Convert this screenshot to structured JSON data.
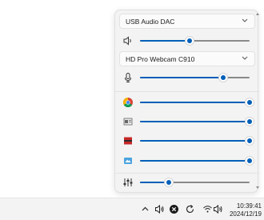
{
  "flyout": {
    "output_device": "USB Audio DAC",
    "output_volume_percent": 45,
    "input_device": "HD Pro Webcam C910",
    "input_volume_percent": 76,
    "apps": [
      {
        "icon": "chrome-icon",
        "volume_percent": 100
      },
      {
        "icon": "media-player-icon",
        "volume_percent": 100
      },
      {
        "icon": "red-app-icon",
        "volume_percent": 100
      },
      {
        "icon": "blue-app-icon",
        "volume_percent": 100
      }
    ],
    "system_sounds_volume_percent": 26
  },
  "colors": {
    "accent": "#005fb8",
    "track": "#8a8a8a",
    "flyout_bg": "#f3f3f3"
  },
  "taskbar": {
    "time": "10:39:41",
    "date": "2024/12/19",
    "icons": [
      "chevron-up-icon",
      "speaker-icon",
      "close-circle-icon",
      "refresh-icon",
      "wifi-icon",
      "volume-icon"
    ]
  }
}
